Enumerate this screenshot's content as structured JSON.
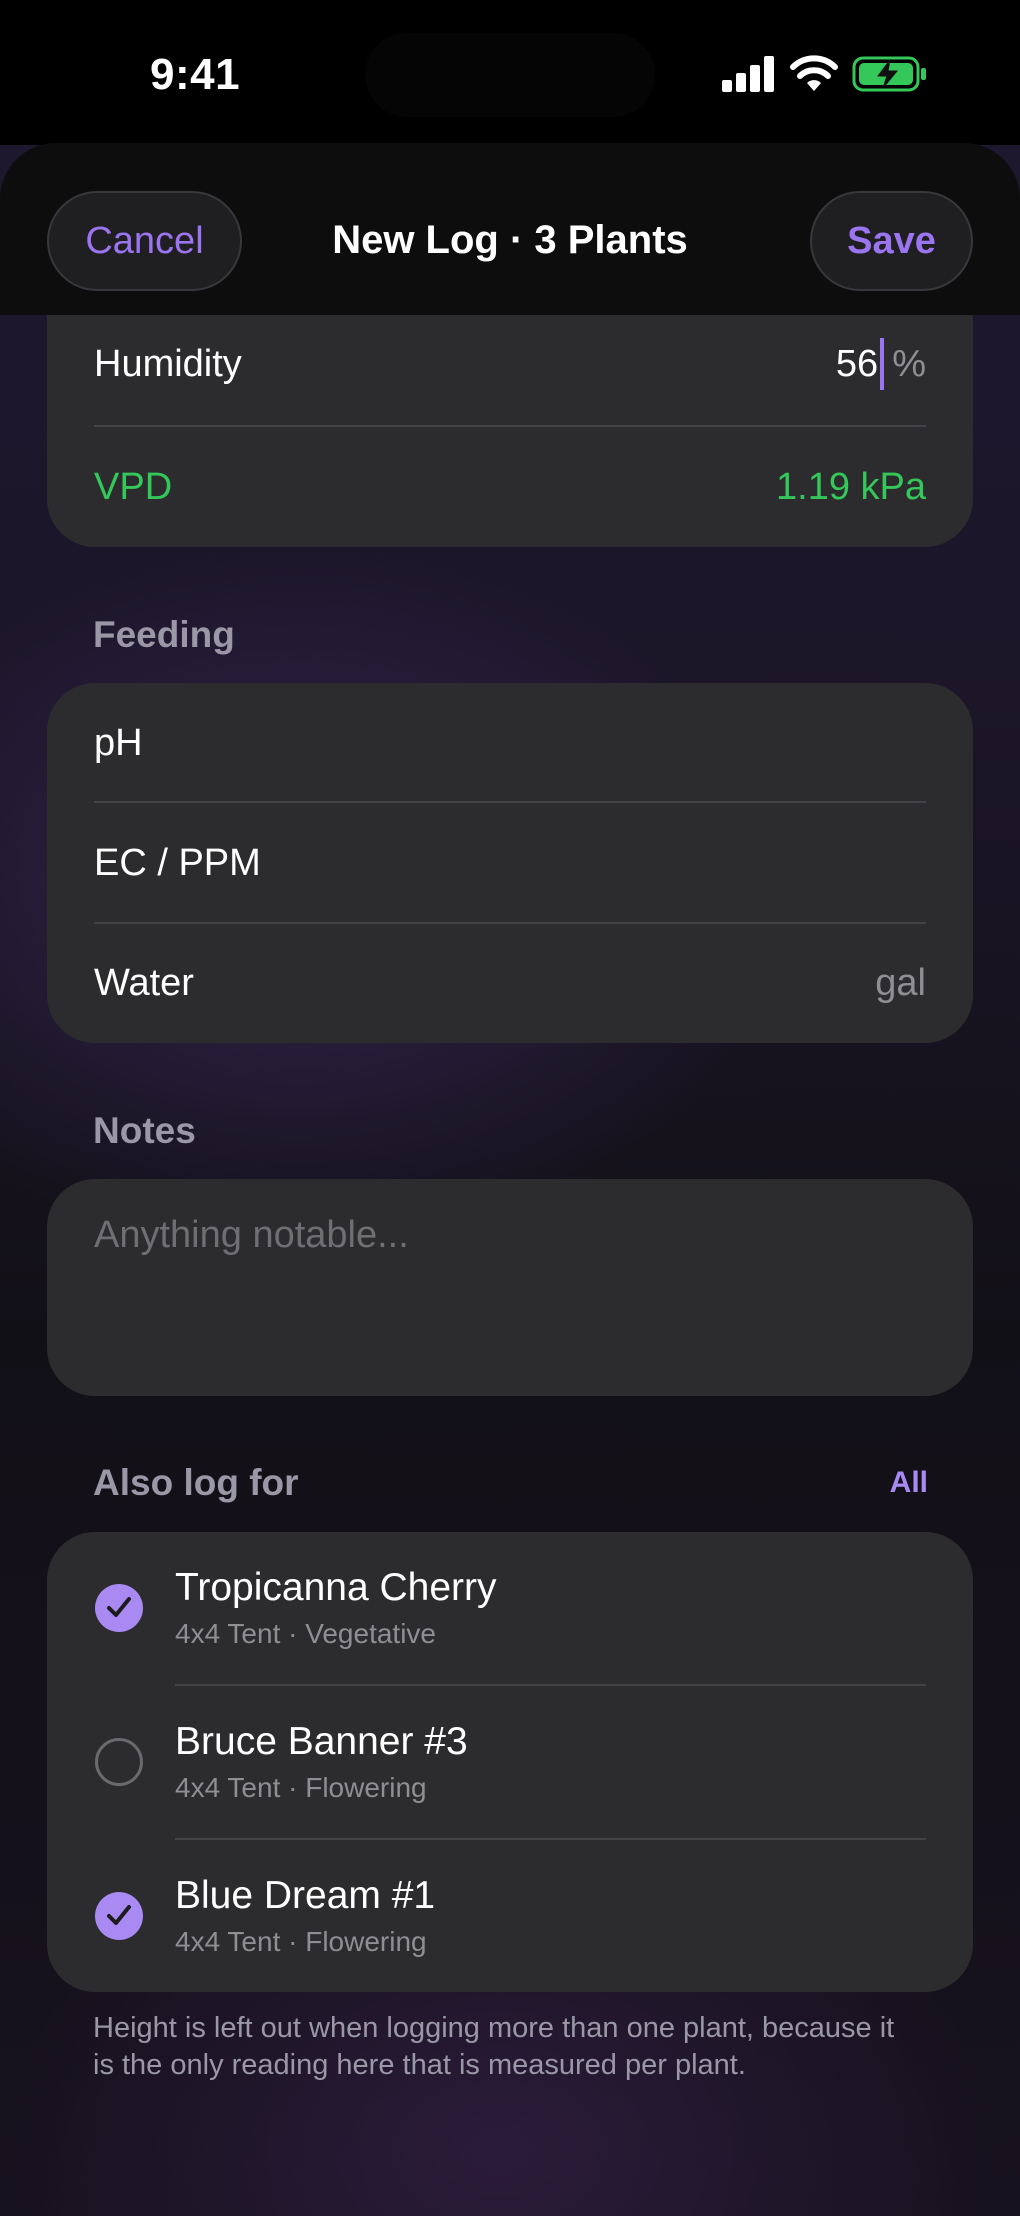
{
  "status_bar": {
    "time": "9:41"
  },
  "header": {
    "cancel_label": "Cancel",
    "title": "New Log · 3 Plants",
    "save_label": "Save"
  },
  "environment": {
    "humidity_label": "Humidity",
    "humidity_value": "56",
    "humidity_unit": "%",
    "vpd_label": "VPD",
    "vpd_value": "1.19 kPa",
    "vpd_color": "#34c759"
  },
  "feeding": {
    "section_label": "Feeding",
    "ph_label": "pH",
    "ec_label": "EC / PPM",
    "water_label": "Water",
    "water_unit": "gal"
  },
  "notes": {
    "section_label": "Notes",
    "placeholder": "Anything notable..."
  },
  "also_log": {
    "section_label": "Also log for",
    "all_label": "All",
    "plants": [
      {
        "name": "Tropicanna Cherry",
        "detail": "4x4 Tent · Vegetative",
        "checked": true
      },
      {
        "name": "Bruce Banner #3",
        "detail": "4x4 Tent · Flowering",
        "checked": false
      },
      {
        "name": "Blue Dream #1",
        "detail": "4x4 Tent · Flowering",
        "checked": true
      }
    ]
  },
  "footnote": "Height is left out when logging more than one plant, because it is the only reading here that is measured per plant.",
  "colors": {
    "accent": "#9b74f0",
    "checkbox_on": "#a98af2",
    "card": "#2c2c2e"
  }
}
